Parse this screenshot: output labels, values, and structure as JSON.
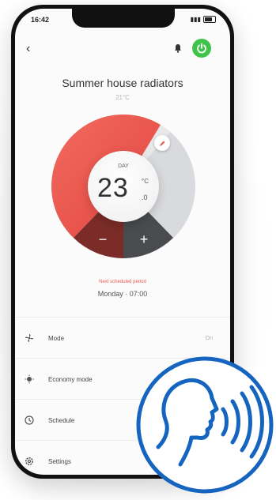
{
  "status": {
    "time": "16:42"
  },
  "header": {
    "title": "Summer house radiators",
    "subtitle": "21°C"
  },
  "thermostat": {
    "day_label": "DAY",
    "temperature": "23",
    "unit": "°C",
    "decimal": ".0",
    "minus_label": "−",
    "plus_label": "+"
  },
  "schedule": {
    "next_label": "Next scheduled period",
    "next_time": "Monday · 07:00"
  },
  "menu": {
    "items": [
      {
        "label": "Mode",
        "value": "On"
      },
      {
        "label": "Economy mode",
        "value": ""
      },
      {
        "label": "Schedule",
        "value": ""
      },
      {
        "label": "Settings",
        "value": ""
      }
    ]
  },
  "colors": {
    "accent_red": "#ea4c45",
    "power_green": "#3fc34b",
    "voice_blue": "#1565c0"
  }
}
